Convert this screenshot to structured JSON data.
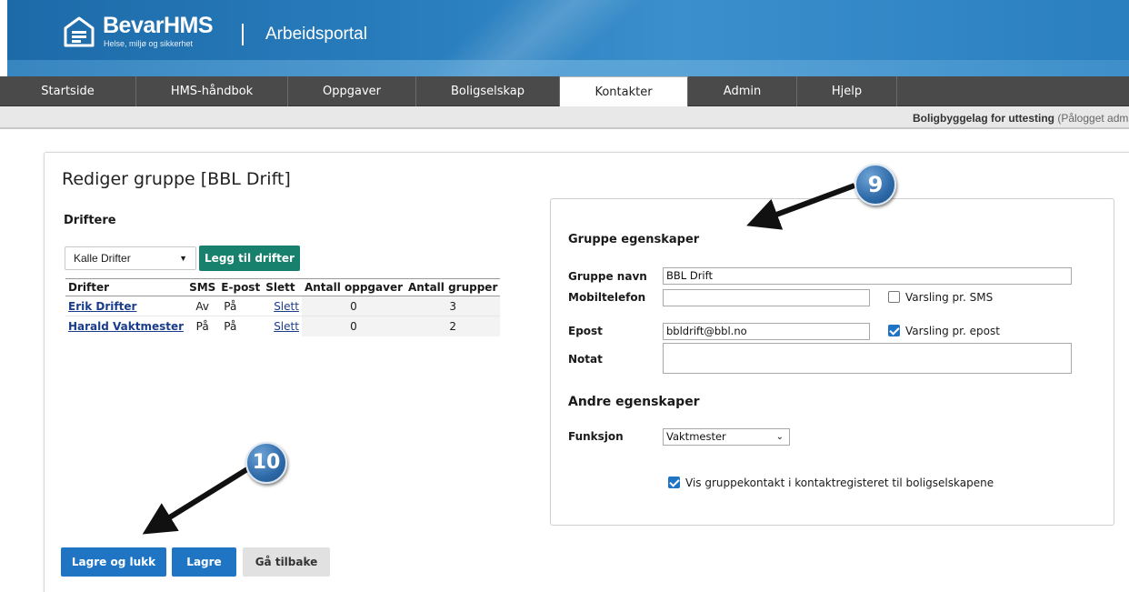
{
  "header": {
    "brand_name": "BevarHMS",
    "brand_tagline": "Helse, miljø og sikkerhet",
    "portal_title": "Arbeidsportal"
  },
  "nav": {
    "items": [
      {
        "label": "Startside"
      },
      {
        "label": "HMS-håndbok"
      },
      {
        "label": "Oppgaver"
      },
      {
        "label": "Boligselskap"
      },
      {
        "label": "Kontakter",
        "active": true
      },
      {
        "label": "Admin"
      },
      {
        "label": "Hjelp"
      }
    ]
  },
  "status": {
    "org": "Boligbyggelag for uttesting",
    "login": "(Pålogget adm"
  },
  "page": {
    "title": "Rediger gruppe [BBL Drift]"
  },
  "driftere": {
    "section_title": "Driftere",
    "select_value": "Kalle Drifter",
    "add_button": "Legg til drifter",
    "columns": [
      "Drifter",
      "SMS",
      "E-post",
      "Slett",
      "Antall oppgaver",
      "Antall grupper"
    ],
    "rows": [
      {
        "name": "Erik Drifter",
        "sms": "Av",
        "epost": "På",
        "slett": "Slett",
        "oppgaver": "0",
        "grupper": "3"
      },
      {
        "name": "Harald Vaktmester",
        "sms": "På",
        "epost": "På",
        "slett": "Slett",
        "oppgaver": "0",
        "grupper": "2"
      }
    ]
  },
  "gruppe": {
    "section_title": "Gruppe egenskaper",
    "navn_label": "Gruppe navn",
    "navn_value": "BBL Drift",
    "mobil_label": "Mobiltelefon",
    "mobil_value": "",
    "sms_check_label": "Varsling pr. SMS",
    "sms_checked": false,
    "epost_label": "Epost",
    "epost_value": "bbldrift@bbl.no",
    "epost_check_label": "Varsling pr. epost",
    "epost_checked": true,
    "notat_label": "Notat",
    "notat_value": ""
  },
  "andre": {
    "section_title": "Andre egenskaper",
    "funksjon_label": "Funksjon",
    "funksjon_value": "Vaktmester",
    "vis_label": "Vis gruppekontakt i kontaktregisteret til boligselskapene",
    "vis_checked": true
  },
  "buttons": {
    "save_close": "Lagre og lukk",
    "save": "Lagre",
    "back": "Gå tilbake"
  },
  "callouts": {
    "first": "9",
    "second": "10"
  },
  "colors": {
    "banner": "#2a7fbf",
    "nav": "#4a4a4a",
    "green_button": "#17816d",
    "blue_button": "#1f75c4",
    "link": "#1b3c8a"
  }
}
